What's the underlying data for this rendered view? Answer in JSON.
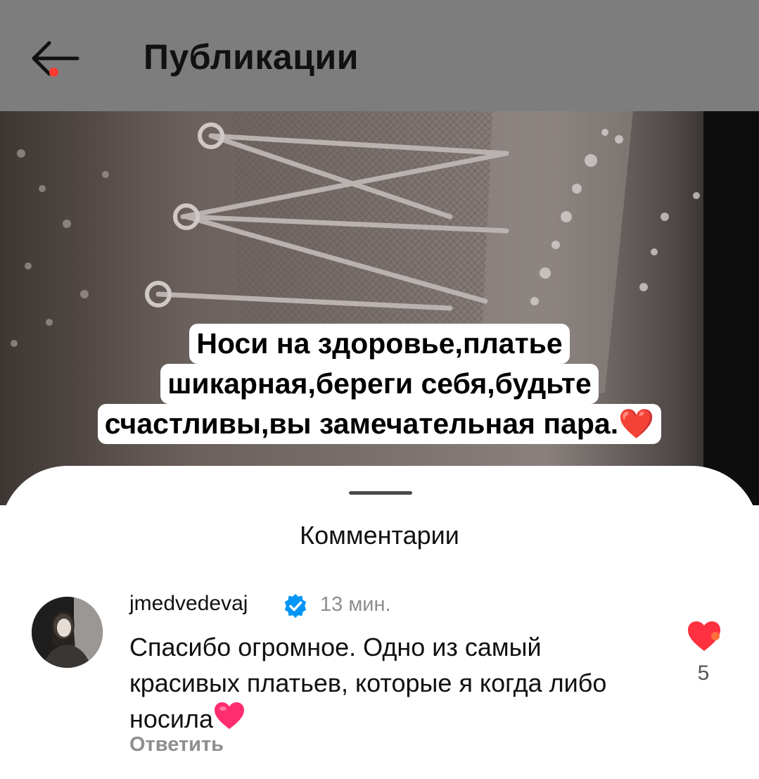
{
  "header": {
    "title": "Публикации",
    "back_icon": "arrow-left-icon",
    "notification_dot_color": "#ff3b30"
  },
  "post": {
    "caption_lines": [
      "Носи на здоровье,платье",
      "шикарная,береги себя,будьте",
      "счастливы,вы замечательная пара."
    ],
    "caption_emoji": "❤️"
  },
  "comments_sheet": {
    "title": "Комментарии",
    "comment": {
      "username": "jmedvedevaj",
      "verified": true,
      "time": "13 мин.",
      "text": "Спасибо огромное. Одно из самый красивых платьев, которые я когда либо носила",
      "text_emoji": "❤️",
      "reply_label": "Ответить",
      "like_count": "5",
      "liked": true
    }
  },
  "colors": {
    "header_bg": "#7d7d7d",
    "like_red": "#ff3040",
    "verified_blue": "#0095f6"
  }
}
